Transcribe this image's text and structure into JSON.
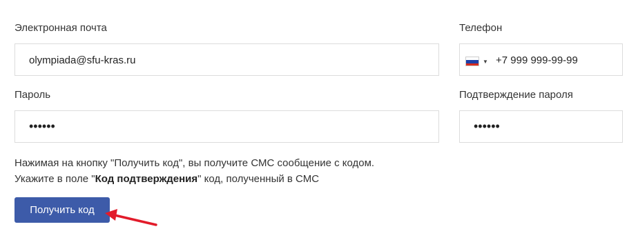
{
  "email": {
    "label": "Электронная почта",
    "value": "olympiada@sfu-kras.ru"
  },
  "phone": {
    "label": "Телефон",
    "value": "+7 999 999-99-99",
    "country_flag": "russia-flag-icon"
  },
  "password": {
    "label": "Пароль",
    "value": "••••••"
  },
  "password_confirm": {
    "label": "Подтверждение пароля",
    "value": "••••••"
  },
  "info": {
    "line1": "Нажимая на кнопку \"Получить код\", вы получите СМС сообщение с кодом.",
    "line2_prefix": "Укажите в поле \"",
    "line2_bold": "Код подтверждения",
    "line2_suffix": "\" код, полученный в СМС"
  },
  "get_code_button": {
    "label": "Получить код",
    "color": "#3d5ba9"
  },
  "annotation_arrow": {
    "color": "#e21b2a",
    "icon": "red-arrow-icon"
  }
}
